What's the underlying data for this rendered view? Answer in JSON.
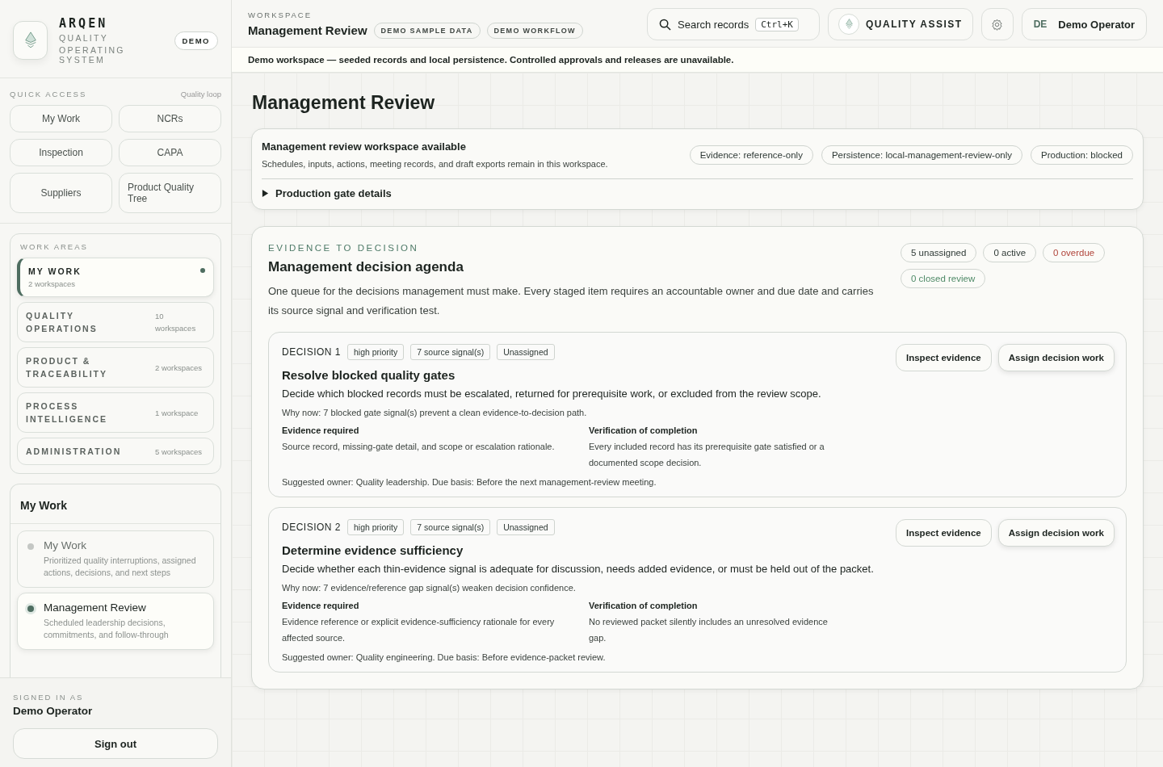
{
  "sidebar": {
    "brand": {
      "name": "ARQEN",
      "line1": "QUALITY",
      "line2": "OPERATING SYSTEM",
      "badge": "DEMO"
    },
    "quick_access": {
      "title": "QUICK ACCESS",
      "hint": "Quality loop",
      "items": [
        "My Work",
        "NCRs",
        "Inspection",
        "CAPA",
        "Suppliers",
        "Product Quality Tree"
      ]
    },
    "work_areas": {
      "title": "WORK AREAS",
      "items": [
        {
          "label": "MY WORK",
          "count": "2 workspaces",
          "selected": true
        },
        {
          "label": "QUALITY OPERATIONS",
          "count": "10 workspaces",
          "selected": false
        },
        {
          "label": "PRODUCT & TRACEABILITY",
          "count": "2 workspaces",
          "selected": false
        },
        {
          "label": "PROCESS INTELLIGENCE",
          "count": "1 workspace",
          "selected": false
        },
        {
          "label": "ADMINISTRATION",
          "count": "5 workspaces",
          "selected": false
        }
      ]
    },
    "workspaces": {
      "title": "My Work",
      "items": [
        {
          "title": "My Work",
          "description": "Prioritized quality interruptions, assigned actions, decisions, and next steps",
          "selected": false
        },
        {
          "title": "Management Review",
          "description": "Scheduled leadership decisions, commitments, and follow-through",
          "selected": true
        }
      ]
    },
    "signed_in": {
      "label": "SIGNED IN AS",
      "name": "Demo Operator",
      "button": "Sign out"
    }
  },
  "header": {
    "eyebrow": "WORKSPACE",
    "title": "Management Review",
    "tags": [
      "DEMO SAMPLE DATA",
      "DEMO WORKFLOW"
    ],
    "search": {
      "label": "Search records",
      "shortcut": "Ctrl+K"
    },
    "assist": "QUALITY ASSIST",
    "user": {
      "initials": "DE",
      "name": "Demo Operator"
    }
  },
  "banner": "Demo workspace — seeded records and local persistence. Controlled approvals and releases are unavailable.",
  "page_title": "Management Review",
  "notice": {
    "title": "Management review workspace available",
    "text": "Schedules, inputs, actions, meeting records, and draft exports remain in this workspace.",
    "chips": [
      "Evidence: reference-only",
      "Persistence: local-management-review-only",
      "Production: blocked"
    ],
    "details": "Production gate details",
    "expanded": false
  },
  "agenda": {
    "eyebrow": "EVIDENCE TO DECISION",
    "title": "Management decision agenda",
    "text": "One queue for the decisions management must make. Every staged item requires an accountable owner and due date and carries its source signal and verification test.",
    "counts": [
      {
        "label": "5 unassigned",
        "color": "#2f3a36"
      },
      {
        "label": "0 active",
        "color": "#2f3a36"
      },
      {
        "label": "0 overdue",
        "color": "#b0443a"
      },
      {
        "label": "0 closed review",
        "color": "#4f8a67"
      }
    ],
    "decisions": [
      {
        "number": "DECISION 1",
        "tags": [
          "high priority",
          "7 source signal(s)",
          "Unassigned"
        ],
        "title": "Resolve blocked quality gates",
        "text": "Decide which blocked records must be escalated, returned for prerequisite work, or excluded from the review scope.",
        "why": "Why now: 7 blocked gate signal(s) prevent a clean evidence-to-decision path.",
        "evidence_label": "Evidence required",
        "evidence": "Source record, missing-gate detail, and scope or escalation rationale.",
        "verification_label": "Verification of completion",
        "verification": "Every included record has its prerequisite gate satisfied or a documented scope decision.",
        "owner": "Suggested owner: Quality leadership. Due basis: Before the next management-review meeting.",
        "actions": [
          "Inspect evidence",
          "Assign decision work"
        ]
      },
      {
        "number": "DECISION 2",
        "tags": [
          "high priority",
          "7 source signal(s)",
          "Unassigned"
        ],
        "title": "Determine evidence sufficiency",
        "text": "Decide whether each thin-evidence signal is adequate for discussion, needs added evidence, or must be held out of the packet.",
        "why": "Why now: 7 evidence/reference gap signal(s) weaken decision confidence.",
        "evidence_label": "Evidence required",
        "evidence": "Evidence reference or explicit evidence-sufficiency rationale for every affected source.",
        "verification_label": "Verification of completion",
        "verification": "No reviewed packet silently includes an unresolved evidence gap.",
        "owner": "Suggested owner: Quality engineering. Due basis: Before evidence-packet review.",
        "actions": [
          "Inspect evidence",
          "Assign decision work"
        ]
      }
    ]
  }
}
